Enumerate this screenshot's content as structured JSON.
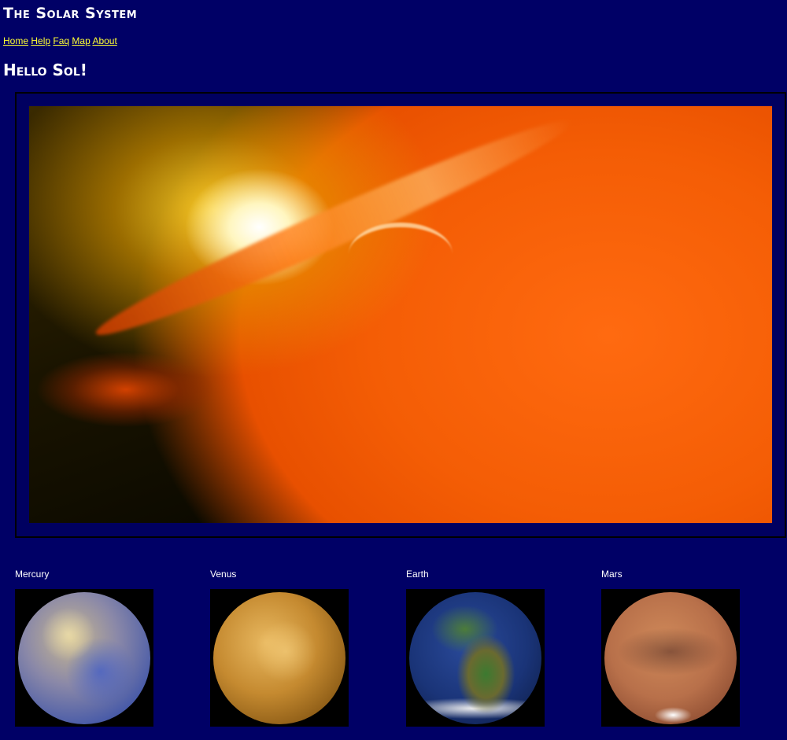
{
  "site": {
    "title": "The Solar System"
  },
  "nav": {
    "items": [
      "Home",
      "Help",
      "Faq",
      "Map",
      "About"
    ],
    "link_color": "#ffff33"
  },
  "page": {
    "heading": "Hello Sol!",
    "background_color": "#000066"
  },
  "hero": {
    "image": "sun-solar-flare-image"
  },
  "planets": [
    {
      "name": "Mercury",
      "image": "mercury-image"
    },
    {
      "name": "Venus",
      "image": "venus-image"
    },
    {
      "name": "Earth",
      "image": "earth-image"
    },
    {
      "name": "Mars",
      "image": "mars-image"
    }
  ]
}
